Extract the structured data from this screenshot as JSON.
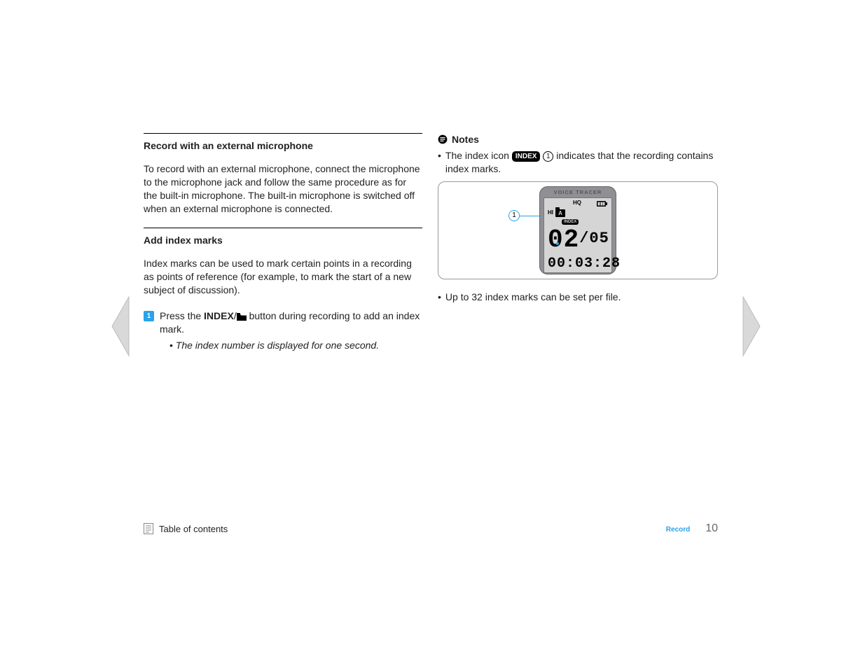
{
  "left_column": {
    "section1": {
      "heading": "Record with an external microphone",
      "paragraph": "To record with an external microphone, connect the microphone to the microphone jack and follow the same procedure as for the built-in microphone. The built-in microphone is switched off when an external microphone is connected."
    },
    "section2": {
      "heading": "Add index marks",
      "paragraph": "Index marks can be used to mark certain points in a recording as points of reference (for example, to mark the start of a new subject of discussion).",
      "step_badge": "1",
      "step_text_prefix": "Press the ",
      "step_text_bold": "INDEX",
      "step_text_slash": "/",
      "step_text_suffix": " button during recording to add an index mark.",
      "step_bullet_dot": "•",
      "step_bullet_text": "The index number is displayed for one second."
    }
  },
  "right_column": {
    "notes_label": "Notes",
    "note1": {
      "dot": "•",
      "t1": "The index icon ",
      "pill": "INDEX",
      "circled": "1",
      "t2": " indicates that the recording contains index marks."
    },
    "device": {
      "brand": "VOICE TRACER",
      "hq": "HQ",
      "hi": "HI",
      "folder_letter": "A",
      "index_tag": "INDEX",
      "callout_num": "1",
      "big_num": "02",
      "big_sep_total": "/05",
      "time": "00:03:28"
    },
    "note2": {
      "dot": "•",
      "text": "Up to 32 index marks can be set per file."
    }
  },
  "footer": {
    "toc": "Table of contents",
    "section": "Record",
    "page": "10"
  }
}
